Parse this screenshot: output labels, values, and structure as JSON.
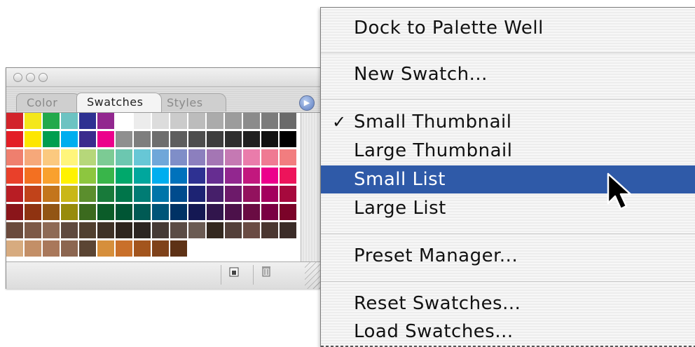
{
  "palette": {
    "tabs": [
      {
        "label": "Color",
        "active": false
      },
      {
        "label": "Swatches",
        "active": true
      },
      {
        "label": "Styles",
        "active": false
      }
    ],
    "swatch_rows": [
      [
        "#d2232a",
        "#f4e71b",
        "#22a94b",
        "#6cc3c2",
        "#2e3192",
        "#92278f",
        "#ffffff",
        "#ececec",
        "#dcdcdc",
        "#cbcbcb",
        "#bcbcbc",
        "#ababab",
        "#9c9c9c",
        "#8b8b8b",
        "#7b7b7b",
        "#6a6a6a"
      ],
      [
        "#e31e26",
        "#fde600",
        "#009e4f",
        "#00aeef",
        "#3b2b8d",
        "#ec008c",
        "#8f8f8f",
        "#7e7e7e",
        "#6e6e6e",
        "#5e5e5e",
        "#4e4e4e",
        "#3e3e3e",
        "#2f2f2f",
        "#202020",
        "#111111",
        "#000000"
      ],
      [
        "#ef7f6e",
        "#f6a87a",
        "#fbc97f",
        "#fff57b",
        "#b6d77a",
        "#7ccb94",
        "#6cc7b0",
        "#67c7d6",
        "#6fa7d9",
        "#7f8ec8",
        "#8c7fbe",
        "#a476b4",
        "#c579b3",
        "#ea7cab",
        "#ef7a93",
        "#f27d7f"
      ],
      [
        "#e9402a",
        "#f37021",
        "#f9a12e",
        "#fff200",
        "#8dc63f",
        "#39b54a",
        "#00a86b",
        "#00a79d",
        "#00aeef",
        "#0072bc",
        "#2e3192",
        "#662d91",
        "#92278f",
        "#c2187e",
        "#ec008c",
        "#ed145b"
      ],
      [
        "#b81d24",
        "#c1431a",
        "#c3751c",
        "#c9b717",
        "#5b8e2d",
        "#187a3a",
        "#00754a",
        "#007c74",
        "#0075a9",
        "#004b8d",
        "#1d2373",
        "#461f6a",
        "#6d1a6a",
        "#93125e",
        "#a3005e",
        "#a6093d"
      ],
      [
        "#8a151a",
        "#8f3311",
        "#925514",
        "#978b0c",
        "#3b6a1e",
        "#0b5c29",
        "#005534",
        "#005a54",
        "#005478",
        "#003265",
        "#141853",
        "#31154c",
        "#4c114a",
        "#6a0c43",
        "#7a0043",
        "#7b0329"
      ],
      [
        "#6a4a3c",
        "#7d5947",
        "#8e6a55",
        "#5f4a3e",
        "#51402f",
        "#3f3227",
        "#2e251e",
        "#2c2521",
        "#453a35",
        "#5b4c45",
        "#6b5b53",
        "#34281f",
        "#54403a",
        "#6a4b43",
        "#4a3630",
        "#3b2c28"
      ],
      [
        "#d7ab7f",
        "#c38f67",
        "#a9785b",
        "#8c6650",
        "#5b4533",
        "#d68f3b",
        "#c9702a",
        "#a3551d",
        "#7f421a",
        "#5e3216"
      ]
    ],
    "bottom_icons": [
      "new-swatch-icon",
      "trash-icon"
    ]
  },
  "menu": {
    "items": [
      {
        "label": "Dock to Palette Well",
        "checked": false,
        "highlighted": false
      },
      {
        "label": "New Swatch...",
        "checked": false,
        "highlighted": false
      },
      {
        "label": "Small Thumbnail",
        "checked": true,
        "highlighted": false
      },
      {
        "label": "Large Thumbnail",
        "checked": false,
        "highlighted": false
      },
      {
        "label": "Small List",
        "checked": false,
        "highlighted": true
      },
      {
        "label": "Large List",
        "checked": false,
        "highlighted": false
      },
      {
        "label": "Preset Manager...",
        "checked": false,
        "highlighted": false
      },
      {
        "label": "Reset Swatches...",
        "checked": false,
        "highlighted": false
      },
      {
        "label": "Load Swatches...",
        "checked": false,
        "highlighted": false
      }
    ],
    "check_glyph": "✓",
    "highlight_color": "#2f5aa8"
  }
}
